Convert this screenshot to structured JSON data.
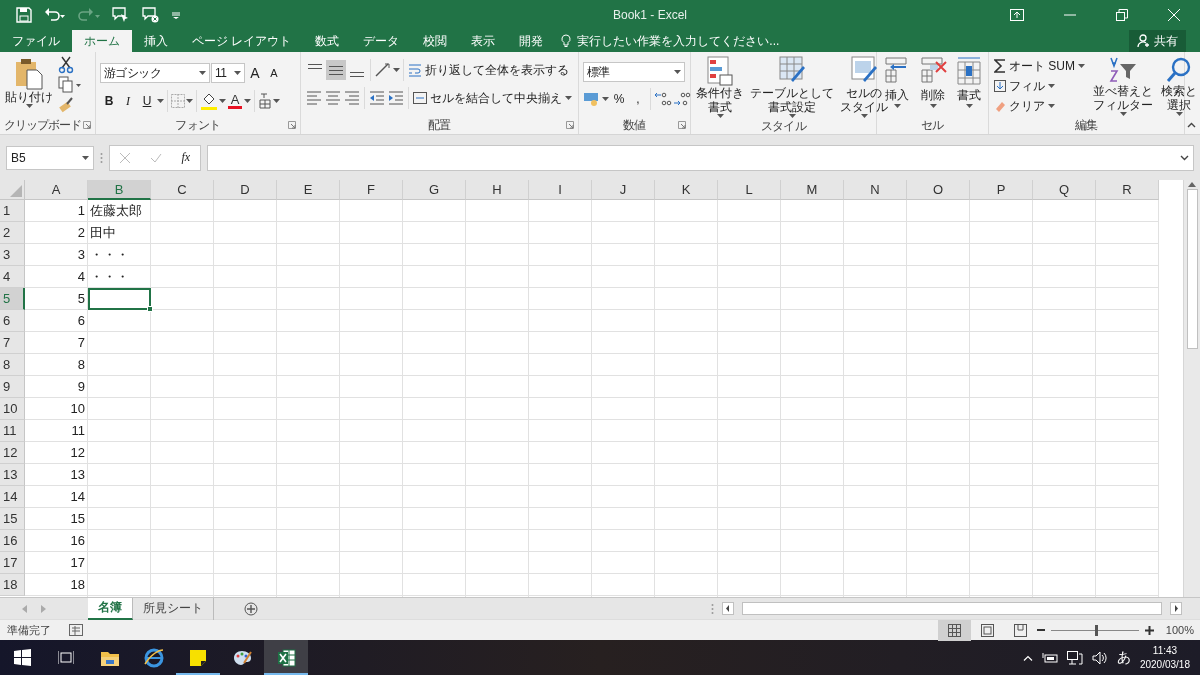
{
  "window": {
    "title": "Book1 - Excel"
  },
  "ribbon_tabs": [
    {
      "label": "ファイル",
      "selected": false
    },
    {
      "label": "ホーム",
      "selected": true
    },
    {
      "label": "挿入",
      "selected": false
    },
    {
      "label": "ページ レイアウト",
      "selected": false
    },
    {
      "label": "数式",
      "selected": false
    },
    {
      "label": "データ",
      "selected": false
    },
    {
      "label": "校閲",
      "selected": false
    },
    {
      "label": "表示",
      "selected": false
    },
    {
      "label": "開発",
      "selected": false
    }
  ],
  "tell_me": {
    "placeholder": "実行したい作業を入力してください..."
  },
  "share_button": "共有",
  "ribbon": {
    "clipboard": {
      "title": "クリップボード",
      "paste_button": "貼り付け"
    },
    "font": {
      "title": "フォント",
      "font_name": "游ゴシック",
      "font_size": "11",
      "grow_button": "A",
      "shrink_button": "A",
      "style_buttons": [
        "B",
        "I",
        "U"
      ],
      "font_color_button": "A"
    },
    "alignment": {
      "title": "配置",
      "vertical_align": [
        {
          "selected": false
        },
        {
          "selected": true
        },
        {
          "selected": false
        }
      ],
      "wrap_text_button": "折り返して全体を表示する",
      "merge_button": "セルを結合して中央揃え"
    },
    "number": {
      "title": "数値",
      "format": "標準",
      "percent_button": "%",
      "comma_button": ","
    },
    "styles": {
      "title": "スタイル",
      "buttons": [
        [
          "条件付き",
          "書式"
        ],
        [
          "テーブルとして",
          "書式設定"
        ],
        [
          "セルの",
          "スタイル"
        ]
      ]
    },
    "cells": {
      "title": "セル",
      "buttons": [
        "挿入",
        "削除",
        "書式"
      ]
    },
    "editing": {
      "title": "編集",
      "autosum_button": "オート SUM",
      "fill_button": "フィル",
      "clear_button": "クリア",
      "sort_button": [
        "並べ替えと",
        "フィルター"
      ],
      "find_button": [
        "検索と",
        "選択"
      ]
    }
  },
  "formula_bar": {
    "name_box": "B5",
    "function_button": "fx"
  },
  "sheet": {
    "columns": [
      {
        "label": "A",
        "selected": false
      },
      {
        "label": "B",
        "selected": true
      },
      {
        "label": "C",
        "selected": false
      },
      {
        "label": "D",
        "selected": false
      },
      {
        "label": "E",
        "selected": false
      },
      {
        "label": "F",
        "selected": false
      },
      {
        "label": "G",
        "selected": false
      },
      {
        "label": "H",
        "selected": false
      },
      {
        "label": "I",
        "selected": false
      },
      {
        "label": "J",
        "selected": false
      },
      {
        "label": "K",
        "selected": false
      },
      {
        "label": "L",
        "selected": false
      },
      {
        "label": "M",
        "selected": false
      },
      {
        "label": "N",
        "selected": false
      },
      {
        "label": "O",
        "selected": false
      },
      {
        "label": "P",
        "selected": false
      },
      {
        "label": "Q",
        "selected": false
      },
      {
        "label": "R",
        "selected": false
      }
    ],
    "rows": [
      {
        "label": "1",
        "selected": false,
        "cells": [
          {
            "text": "1",
            "selected": false
          },
          {
            "text": "佐藤太郎",
            "selected": false
          }
        ]
      },
      {
        "label": "2",
        "selected": false,
        "cells": [
          {
            "text": "2",
            "selected": false
          },
          {
            "text": "田中",
            "selected": false
          }
        ]
      },
      {
        "label": "3",
        "selected": false,
        "cells": [
          {
            "text": "3",
            "selected": false
          },
          {
            "text": "・・・",
            "selected": false
          }
        ]
      },
      {
        "label": "4",
        "selected": false,
        "cells": [
          {
            "text": "4",
            "selected": false
          },
          {
            "text": "・・・",
            "selected": false
          }
        ]
      },
      {
        "label": "5",
        "selected": true,
        "cells": [
          {
            "text": "5",
            "selected": false
          },
          {
            "selected": true
          }
        ]
      },
      {
        "label": "6",
        "selected": false,
        "cells": [
          {
            "text": "6",
            "selected": false
          }
        ]
      },
      {
        "label": "7",
        "selected": false,
        "cells": [
          {
            "text": "7",
            "selected": false
          }
        ]
      },
      {
        "label": "8",
        "selected": false,
        "cells": [
          {
            "text": "8",
            "selected": false
          }
        ]
      },
      {
        "label": "9",
        "selected": false,
        "cells": [
          {
            "text": "9",
            "selected": false
          }
        ]
      },
      {
        "label": "10",
        "selected": false,
        "cells": [
          {
            "text": "10",
            "selected": false
          }
        ]
      },
      {
        "label": "11",
        "selected": false,
        "cells": [
          {
            "text": "11",
            "selected": false
          }
        ]
      },
      {
        "label": "12",
        "selected": false,
        "cells": [
          {
            "text": "12",
            "selected": false
          }
        ]
      },
      {
        "label": "13",
        "selected": false,
        "cells": [
          {
            "text": "13",
            "selected": false
          }
        ]
      },
      {
        "label": "14",
        "selected": false,
        "cells": [
          {
            "text": "14",
            "selected": false
          }
        ]
      },
      {
        "label": "15",
        "selected": false,
        "cells": [
          {
            "text": "15",
            "selected": false
          }
        ]
      },
      {
        "label": "16",
        "selected": false,
        "cells": [
          {
            "text": "16",
            "selected": false
          }
        ]
      },
      {
        "label": "17",
        "selected": false,
        "cells": [
          {
            "text": "17",
            "selected": false
          }
        ]
      },
      {
        "label": "18",
        "selected": false,
        "cells": [
          {
            "text": "18",
            "selected": false
          }
        ]
      }
    ]
  },
  "sheet_tabs": [
    {
      "label": "名簿",
      "selected": true
    },
    {
      "label": "所見シート",
      "selected": false
    }
  ],
  "status_bar": {
    "status": "準備完了",
    "views": [
      {
        "selected": true
      },
      {
        "selected": false
      },
      {
        "selected": false
      }
    ],
    "zoom": {
      "level": 0.5
    },
    "zoom_reading": "100%"
  },
  "taskbar": {
    "apps": [
      {
        "running": false,
        "selected": false
      },
      {
        "running": false,
        "selected": false
      },
      {
        "running": true,
        "selected": false
      },
      {
        "running": false,
        "selected": false
      },
      {
        "running": true,
        "selected": true
      }
    ],
    "ime": "あ",
    "time": "11:43",
    "date": "2020/03/18"
  }
}
